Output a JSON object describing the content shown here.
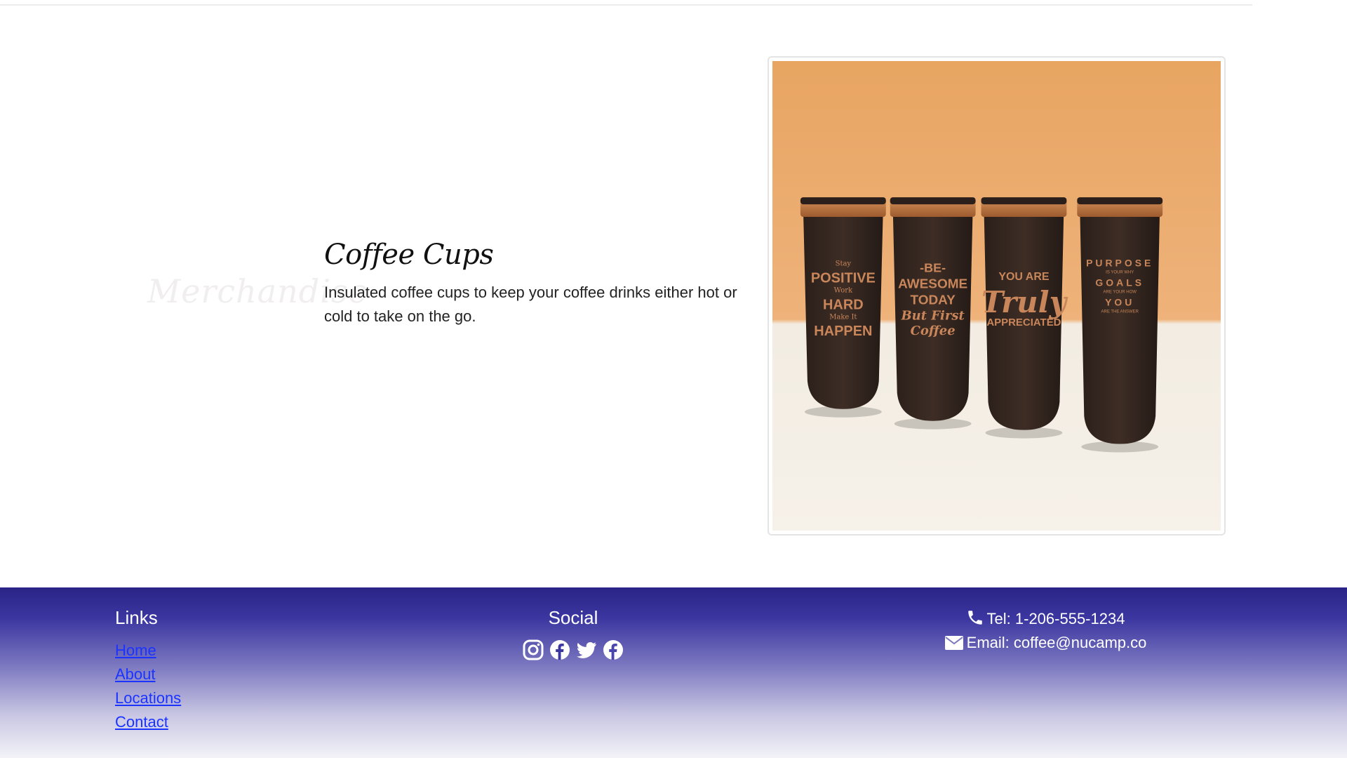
{
  "section": {
    "watermark": "Merchandise"
  },
  "product": {
    "title": "Coffee Cups",
    "description": "Insulated coffee cups to keep your coffee drinks either hot or cold to take on the go.",
    "cups": [
      [
        "Stay",
        "POSITIVE",
        "Work",
        "HARD",
        "Make It",
        "HAPPEN"
      ],
      [
        "-BE-",
        "AWESOME",
        "TODAY",
        "But First",
        "Coffee"
      ],
      [
        "YOU ARE",
        "Truly",
        "APPRECIATED"
      ],
      [
        "PURPOSE",
        "IS YOUR WHY",
        "GOALS",
        "ARE YOUR HOW",
        "YOU",
        "ARE THE ANSWER"
      ]
    ]
  },
  "footer": {
    "links_heading": "Links",
    "links": [
      "Home",
      "About",
      "Locations",
      "Contact"
    ],
    "social_heading": "Social",
    "social_icons": [
      "instagram-icon",
      "facebook-icon",
      "twitter-icon",
      "facebook-icon"
    ],
    "phone": "Tel: 1-206-555-1234",
    "email": "Email: coffee@nucamp.co"
  },
  "colors": {
    "footer_top": "#2a2486",
    "link": "#1a33ff",
    "cup_body": "#3a2b24",
    "cup_text": "#c9865a"
  }
}
